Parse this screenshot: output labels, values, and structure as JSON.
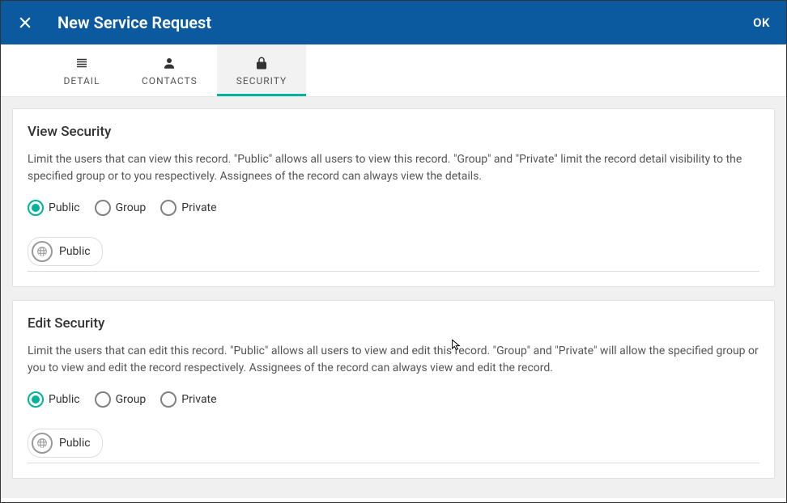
{
  "header": {
    "title": "New Service Request",
    "ok_label": "OK"
  },
  "tabs": [
    {
      "label": "DETAIL",
      "active": false,
      "icon": "list"
    },
    {
      "label": "CONTACTS",
      "active": false,
      "icon": "person"
    },
    {
      "label": "SECURITY",
      "active": true,
      "icon": "lock"
    }
  ],
  "sections": {
    "view": {
      "title": "View Security",
      "desc": "Limit the users that can view this record. \"Public\" allows all users to view this record. \"Group\" and \"Private\" limit the record detail visibility to the specified group or to you respectively. Assignees of the record can always view the details.",
      "radios": [
        {
          "label": "Public",
          "selected": true
        },
        {
          "label": "Group",
          "selected": false
        },
        {
          "label": "Private",
          "selected": false
        }
      ],
      "chip": {
        "label": "Public"
      }
    },
    "edit": {
      "title": "Edit Security",
      "desc": "Limit the users that can edit this record. \"Public\" allows all users to view and edit this record. \"Group\" and \"Private\" will allow the specified group or you to view and edit the record respectively. Assignees of the record can always view and edit the record.",
      "radios": [
        {
          "label": "Public",
          "selected": true
        },
        {
          "label": "Group",
          "selected": false
        },
        {
          "label": "Private",
          "selected": false
        }
      ],
      "chip": {
        "label": "Public"
      }
    }
  }
}
